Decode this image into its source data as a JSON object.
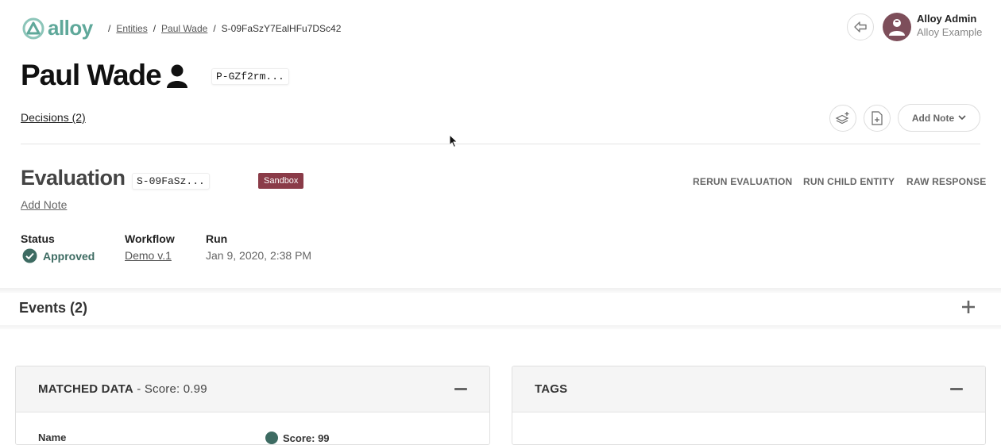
{
  "header": {
    "logo_text": "alloy",
    "breadcrumb": [
      "Entities",
      "Paul Wade",
      "S-09FaSzY7EalHFu7DSc42"
    ],
    "user_name": "Alloy Admin",
    "user_org": "Alloy Example"
  },
  "entity": {
    "name": "Paul Wade",
    "code": "P-GZf2rm...",
    "decisions_label": "Decisions (2)",
    "add_note_button": "Add Note"
  },
  "evaluation": {
    "title": "Evaluation",
    "code": "S-09FaSz...",
    "env_badge": "Sandbox",
    "actions": [
      "RERUN EVALUATION",
      "RUN CHILD ENTITY",
      "RAW RESPONSE"
    ],
    "add_note_link": "Add Note",
    "status_label": "Status",
    "status_value": "Approved",
    "workflow_label": "Workflow",
    "workflow_value": "Demo v.1",
    "run_label": "Run",
    "run_value": "Jan 9, 2020, 2:38 PM"
  },
  "events": {
    "label": "Events (2)"
  },
  "matched_panel": {
    "title": "MATCHED DATA",
    "score": " - Score: 0.99",
    "row_label": "Name",
    "row_value": "Score: 99"
  },
  "tags_panel": {
    "title": "TAGS"
  },
  "colors": {
    "brand": "#5fa89a",
    "badge": "#8a3b48",
    "approved": "#3d6b62"
  }
}
